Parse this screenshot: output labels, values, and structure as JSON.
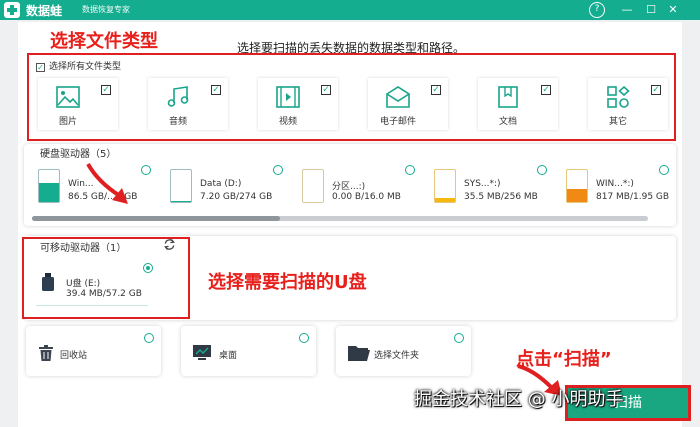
{
  "titlebar": {
    "app_name": "数据蛙",
    "subtitle": "数据恢复专家",
    "help": "?",
    "min": "—",
    "max": "☐",
    "close": "✕"
  },
  "annotations": {
    "select_type": "选择文件类型",
    "select_usb": "选择需要扫描的U盘",
    "click_scan": "点击“扫描”"
  },
  "instruction": "选择要扫描的丢失数据的数据类型和路径。",
  "file_types": {
    "select_all": "选择所有文件类型",
    "items": [
      {
        "label": "图片",
        "icon": "image-icon",
        "checked": true
      },
      {
        "label": "音频",
        "icon": "music-icon",
        "checked": true
      },
      {
        "label": "视频",
        "icon": "video-icon",
        "checked": true
      },
      {
        "label": "电子邮件",
        "icon": "email-icon",
        "checked": true
      },
      {
        "label": "文档",
        "icon": "document-icon",
        "checked": true
      },
      {
        "label": "其它",
        "icon": "other-icon",
        "checked": true
      }
    ]
  },
  "hard_drives": {
    "title": "硬盘驱动器（5）",
    "items": [
      {
        "name": "Win...",
        "size": "86.5 GB/...3 GB",
        "used": 0.6,
        "color": "#14ad8f"
      },
      {
        "name": "Data (D:)",
        "size": "7.20 GB/274 GB",
        "used": 0.03,
        "color": "#14ad8f"
      },
      {
        "name": "分区...:)",
        "size": "0.00  B/16.0 MB",
        "used": 0.0,
        "color": "#14ad8f"
      },
      {
        "name": "SYS...*:)",
        "size": "35.5 MB/256 MB",
        "used": 0.14,
        "color": "#f6b80c"
      },
      {
        "name": "WIN...*:)",
        "size": "817 MB/1.95 GB",
        "used": 0.42,
        "color": "#f08a15"
      }
    ]
  },
  "removable": {
    "title": "可移动驱动器（1）",
    "drive_name": "U盘 (E:)",
    "drive_size": "39.4 MB/57.2 GB"
  },
  "quick_locations": [
    {
      "label": "回收站",
      "icon": "recycle-bin-icon"
    },
    {
      "label": "桌面",
      "icon": "desktop-icon"
    },
    {
      "label": "选择文件夹",
      "icon": "folder-icon"
    }
  ],
  "scan_button": "扫描",
  "watermark": "掘金技术社区 @ 小明助手",
  "colors": {
    "accent": "#14ad8f",
    "annotation": "#e8201c"
  }
}
